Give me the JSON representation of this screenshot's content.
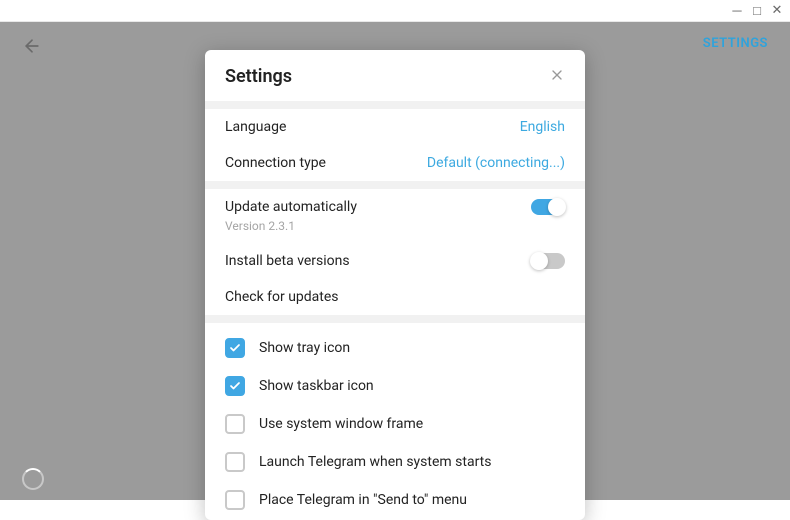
{
  "titlebar": {
    "minimize": "─",
    "maximize": "□",
    "close": "✕"
  },
  "header": {
    "back": "←",
    "settings_link": "SETTINGS"
  },
  "modal": {
    "title": "Settings",
    "close": "✕",
    "language": {
      "label": "Language",
      "value": "English"
    },
    "connection": {
      "label": "Connection type",
      "value": "Default (connecting...)"
    },
    "update_auto": {
      "label": "Update automatically",
      "version": "Version 2.3.1"
    },
    "install_beta": {
      "label": "Install beta versions"
    },
    "check_updates": {
      "label": "Check for updates"
    },
    "tray": {
      "label": "Show tray icon"
    },
    "taskbar": {
      "label": "Show taskbar icon"
    },
    "sysframe": {
      "label": "Use system window frame"
    },
    "launch": {
      "label": "Launch Telegram when system starts"
    },
    "sendto": {
      "label": "Place Telegram in \"Send to\" menu"
    }
  }
}
